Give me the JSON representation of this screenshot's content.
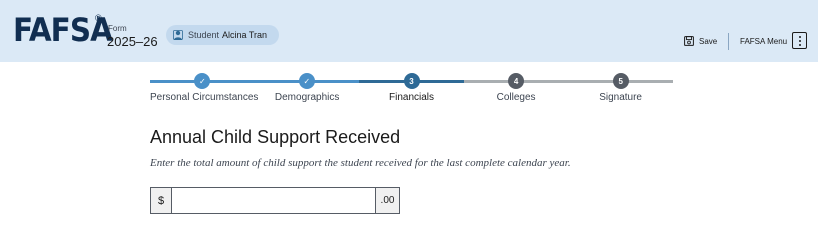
{
  "header": {
    "logo_text": "FAFSA",
    "logo_mark": "®",
    "form_label": "Form",
    "form_year": "2025–26",
    "student_label": "Student",
    "student_name": "Alcina Tran",
    "save_label": "Save",
    "menu_label": "FAFSA Menu"
  },
  "progress": {
    "steps": [
      {
        "label": "Personal Circumstances",
        "number": "✓",
        "state": "complete"
      },
      {
        "label": "Demographics",
        "number": "✓",
        "state": "complete"
      },
      {
        "label": "Financials",
        "number": "3",
        "state": "current"
      },
      {
        "label": "Colleges",
        "number": "4",
        "state": "upcoming"
      },
      {
        "label": "Signature",
        "number": "5",
        "state": "upcoming"
      }
    ]
  },
  "main": {
    "title": "Annual Child Support Received",
    "hint": "Enter the total amount of child support the student received for the last complete calendar year.",
    "amount_prefix": "$",
    "amount_value": "",
    "amount_suffix": ".00"
  },
  "colors": {
    "header_bg": "#dbe9f6",
    "complete": "#4a90c8",
    "current": "#2e6a96",
    "upcoming_line": "#a9aeb1",
    "upcoming_dot": "#565c65"
  }
}
